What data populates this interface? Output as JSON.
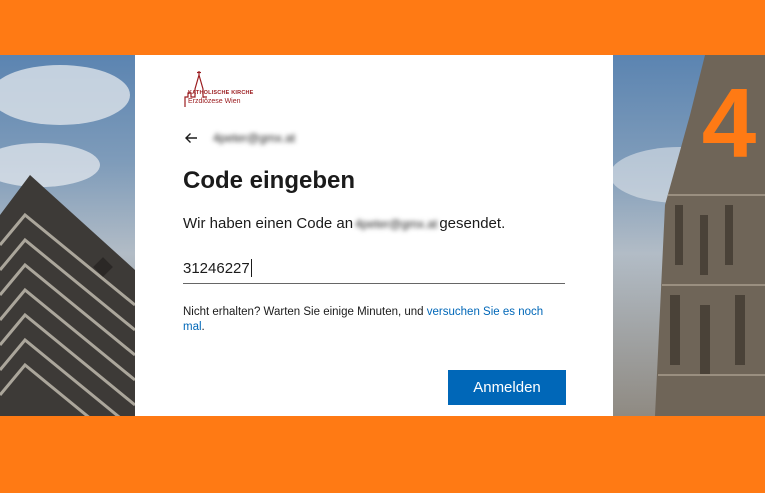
{
  "brand": {
    "line1": "KATHOLISCHE KIRCHE",
    "line2": "Erzdiözese Wien"
  },
  "step": {
    "number": "4"
  },
  "account": {
    "email_masked": "4peter@gmx.at"
  },
  "dialog": {
    "title": "Code eingeben",
    "description_prefix": "Wir haben einen Code an",
    "description_email": "4peter@gmx.at",
    "description_suffix": "gesendet.",
    "code_value": "31246227",
    "hint_text": "Nicht erhalten? Warten Sie einige Minuten, und ",
    "hint_link": "versuchen Sie es noch mal",
    "hint_end": ".",
    "signin_label": "Anmelden"
  },
  "colors": {
    "frame": "#ff7a14",
    "accent": "#0067b8",
    "logo": "#9b1d20"
  },
  "icons": {
    "back": "arrow-left-icon",
    "logo": "cathedral-logo-icon"
  }
}
